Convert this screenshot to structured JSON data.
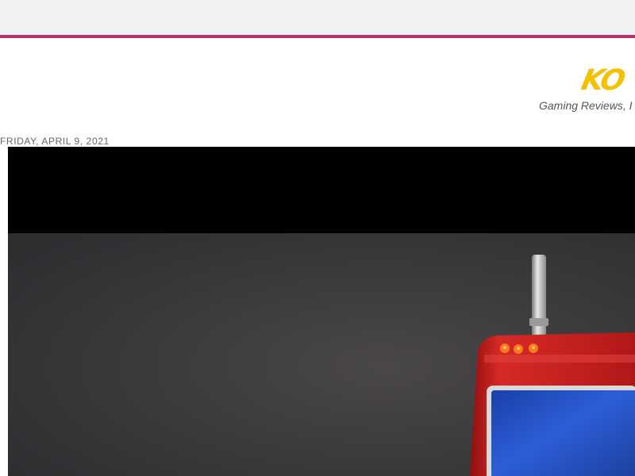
{
  "header": {
    "logo_text": "KO",
    "tagline": "Gaming Reviews, I"
  },
  "post": {
    "date": "FRIDAY, APRIL 9, 2021"
  },
  "colors": {
    "accent_line": "#b5316a",
    "logo": "#f5c000",
    "top_bar": "#f2f2f2"
  },
  "hero": {
    "subject": "red handheld device with blue screen and antenna"
  }
}
